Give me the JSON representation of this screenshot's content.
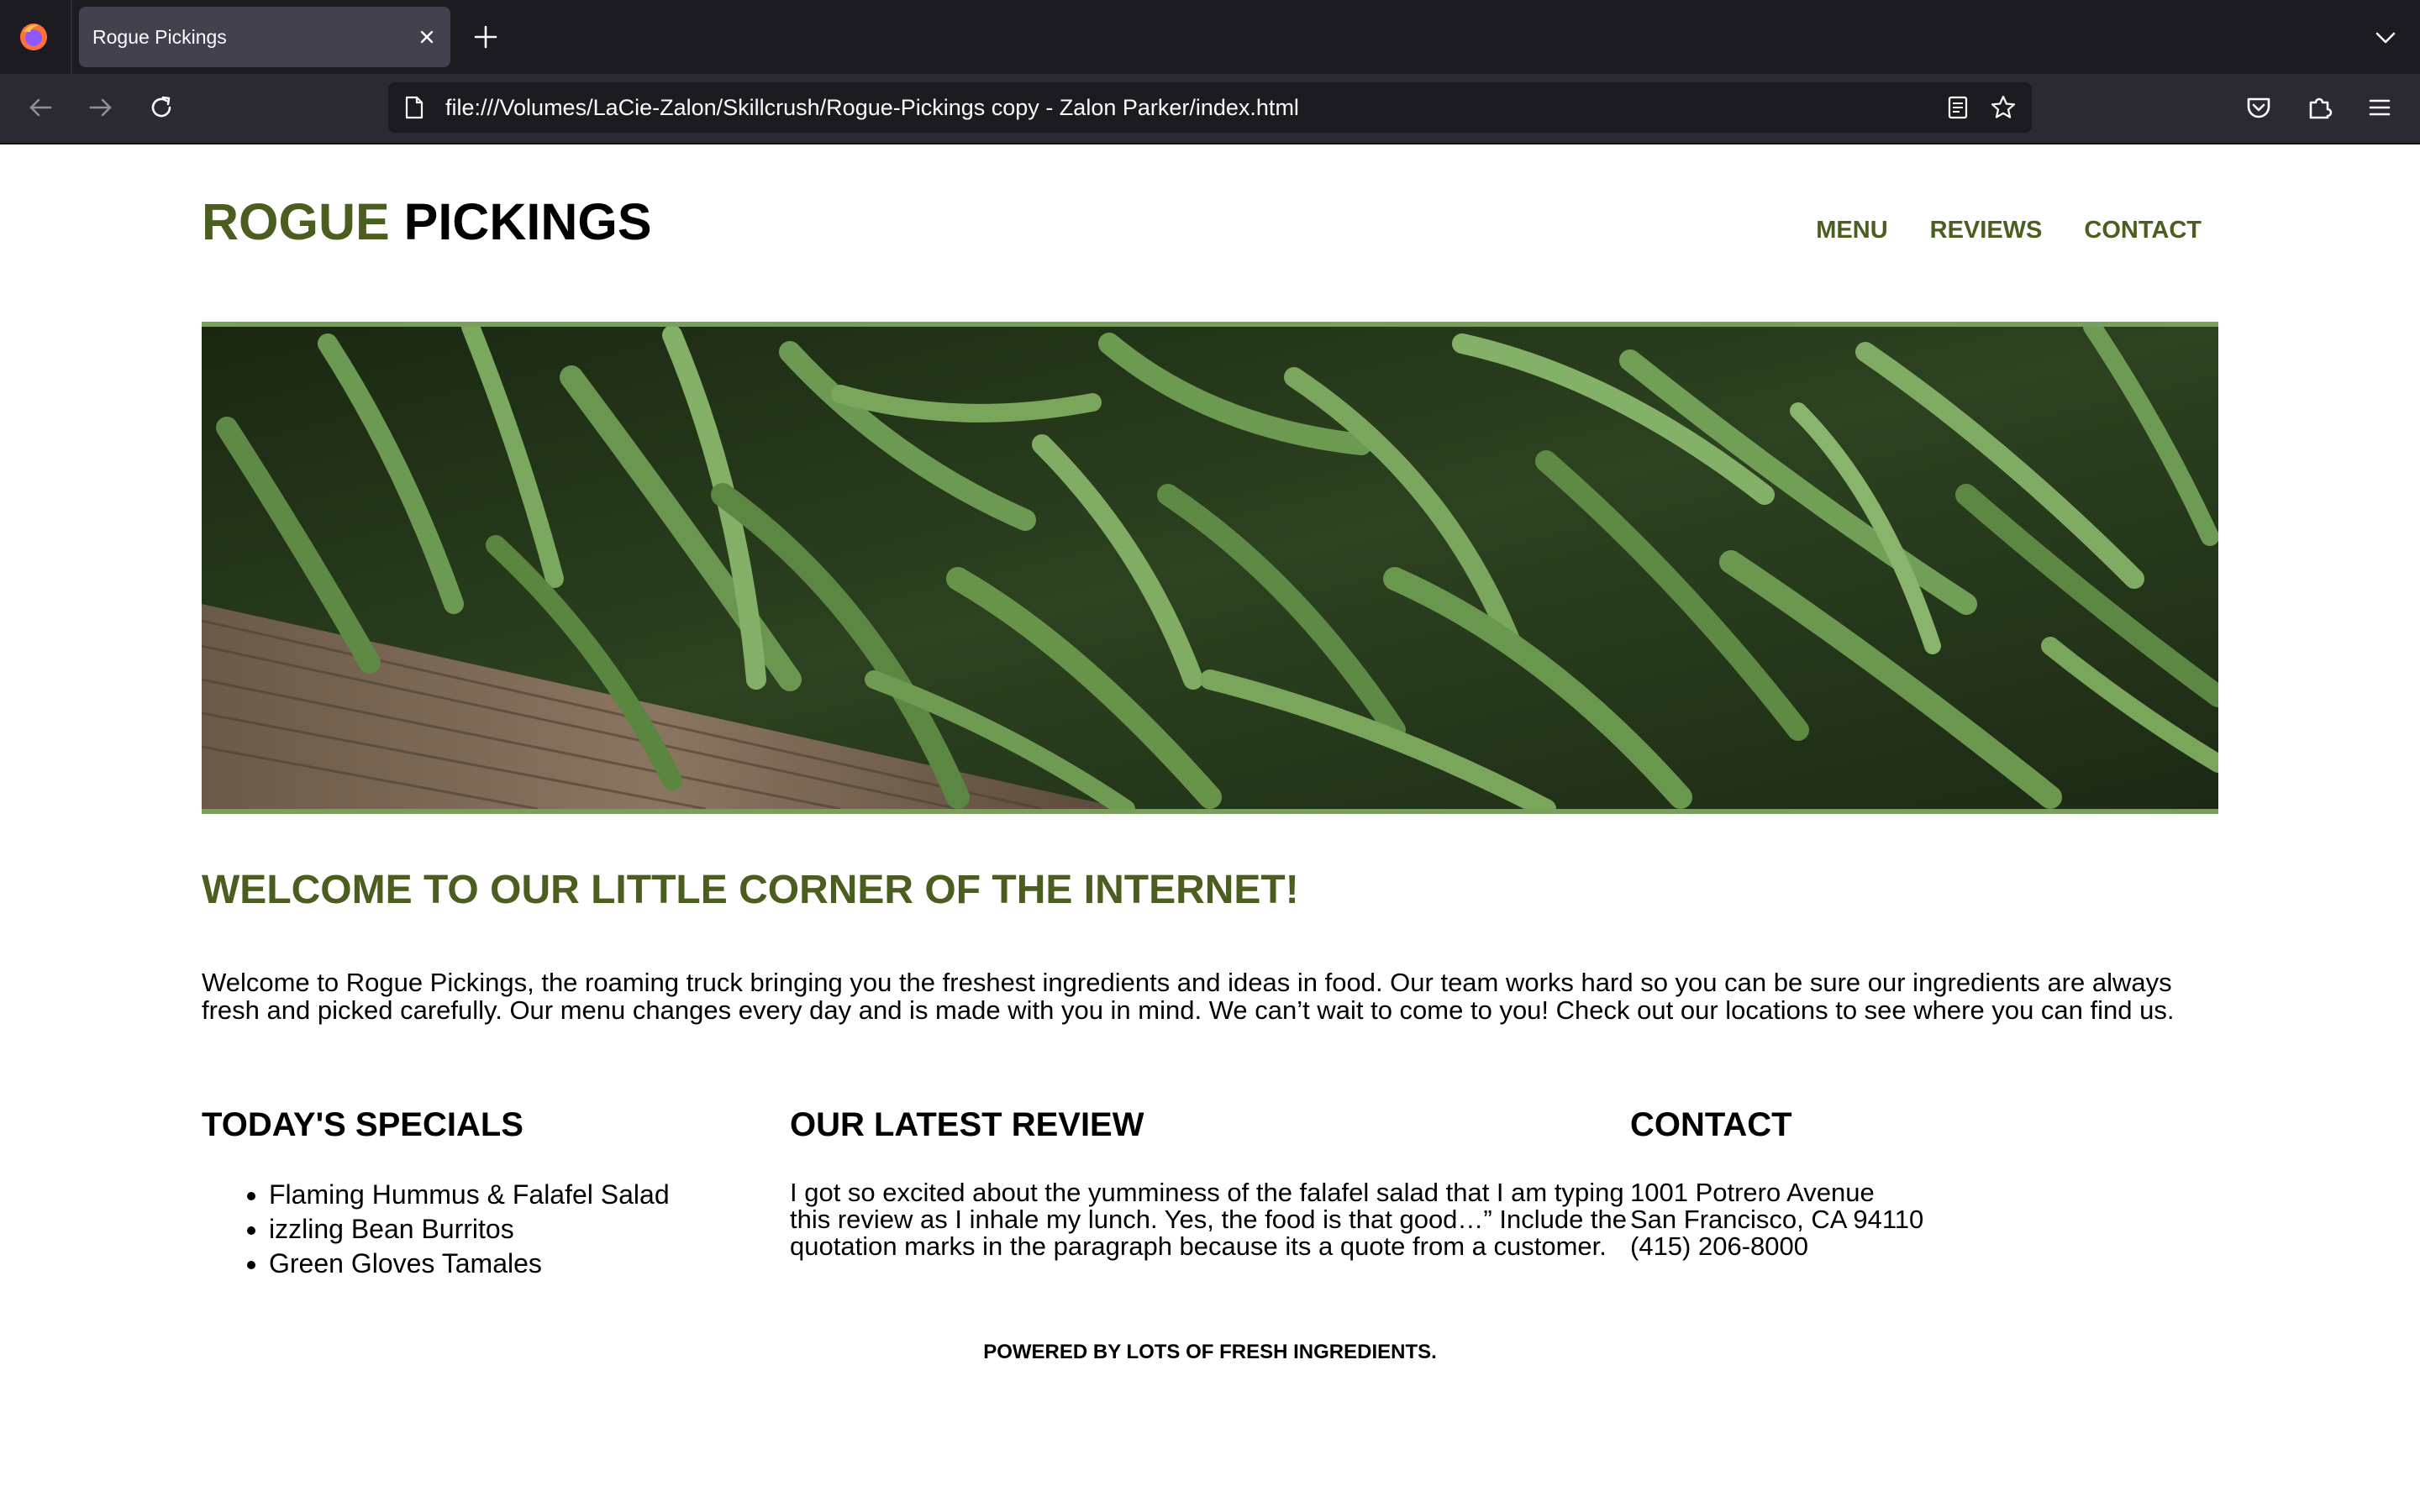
{
  "browser": {
    "tab_title": "Rogue Pickings",
    "url": "file:///Volumes/LaCie-Zalon/Skillcrush/Rogue-Pickings copy - Zalon Parker/index.html",
    "icons": [
      "firefox-logo-icon",
      "close-icon",
      "plus-icon",
      "chevron-down-icon",
      "back-arrow-icon",
      "forward-arrow-icon",
      "reload-icon",
      "page-icon",
      "reader-view-icon",
      "star-icon",
      "pocket-icon",
      "extensions-icon",
      "hamburger-menu-icon"
    ]
  },
  "site": {
    "logo_first": "ROGUE",
    "logo_second": "PICKINGS",
    "brand_green": "#4a5e1f",
    "nav": [
      "MENU",
      "REVIEWS",
      "CONTACT"
    ],
    "hero_image": "green-beans-in-wooden-crate",
    "welcome_title": "WELCOME TO OUR LITTLE CORNER OF THE INTERNET!",
    "welcome_text": "Welcome to Rogue Pickings, the roaming truck bringing you the freshest ingredients and ideas in food. Our team works hard so you can be sure our ingredients are always fresh and picked carefully. Our menu changes every day and is made with you in mind. We can’t wait to come to you! Check out our locations to see where you can find us.",
    "specials_title": "TODAY'S SPECIALS",
    "specials": [
      "Flaming Hummus & Falafel Salad",
      "izzling Bean Burritos",
      "Green Gloves Tamales"
    ],
    "review_title": "OUR LATEST REVIEW",
    "review_text": "I got so excited about the yumminess of the falafel salad that I am typing this review as I inhale my lunch. Yes, the food is that good…” Include the quotation marks in the paragraph because its a quote from a customer.",
    "contact_title": "CONTACT",
    "contact_lines": [
      "1001 Potrero Avenue",
      "San Francisco, CA 94110",
      "(415) 206-8000"
    ],
    "footer": "POWERED BY LOTS OF FRESH INGREDIENTS."
  }
}
